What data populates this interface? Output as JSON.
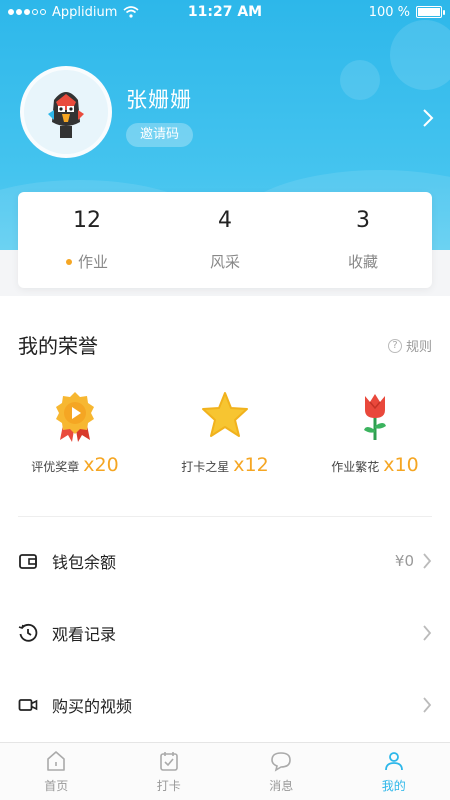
{
  "status_bar": {
    "carrier": "Applidium",
    "time": "11:27 AM",
    "battery": "100 %"
  },
  "profile": {
    "name": "张姗姗",
    "invite_label": "邀请码"
  },
  "stats": [
    {
      "value": "12",
      "label": "作业"
    },
    {
      "value": "4",
      "label": "风采"
    },
    {
      "value": "3",
      "label": "收藏"
    }
  ],
  "honors": {
    "title": "我的荣誉",
    "rules": "规则",
    "items": [
      {
        "label": "评优奖章",
        "count": "x20",
        "icon": "medal-icon"
      },
      {
        "label": "打卡之星",
        "count": "x12",
        "icon": "star-icon"
      },
      {
        "label": "作业繁花",
        "count": "x10",
        "icon": "rose-icon"
      }
    ]
  },
  "menu": [
    {
      "label": "钱包余额",
      "value": "¥0",
      "icon": "wallet-icon"
    },
    {
      "label": "观看记录",
      "value": "",
      "icon": "history-icon"
    },
    {
      "label": "购买的视频",
      "value": "",
      "icon": "video-icon"
    }
  ],
  "tabbar": [
    {
      "label": "首页",
      "icon": "home-icon"
    },
    {
      "label": "打卡",
      "icon": "checkin-icon"
    },
    {
      "label": "消息",
      "icon": "message-icon"
    },
    {
      "label": "我的",
      "icon": "profile-icon"
    }
  ],
  "colors": {
    "primary": "#2db7ea",
    "accent": "#f5a623"
  }
}
